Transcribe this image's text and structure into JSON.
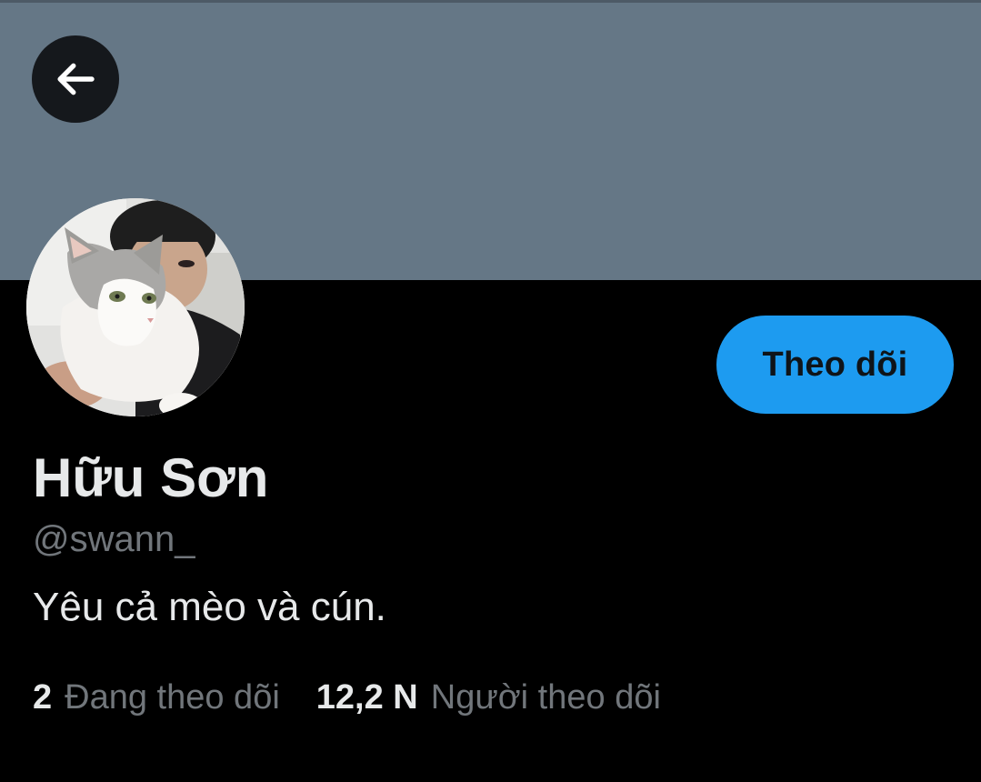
{
  "profile": {
    "display_name": "Hữu Sơn",
    "handle": "@swann_",
    "bio": "Yêu cả mèo và cún.",
    "follow_label": "Theo dõi"
  },
  "stats": {
    "following_count": "2",
    "following_label": "Đang theo dõi",
    "followers_count": "12,2 N",
    "followers_label": "Người theo dõi"
  },
  "icons": {
    "back": "arrow-left-icon"
  },
  "colors": {
    "banner": "#657786",
    "background": "#000000",
    "accent": "#1d9bf0",
    "primary_text": "#e7e9ea",
    "secondary_text": "#71767b"
  }
}
